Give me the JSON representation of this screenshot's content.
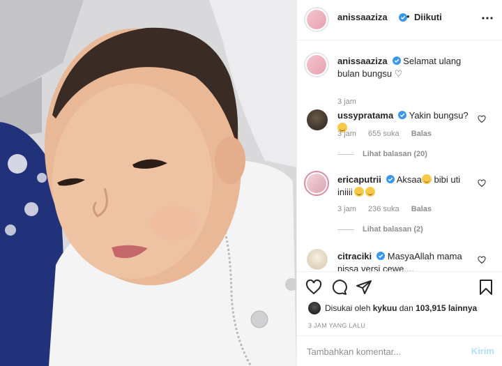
{
  "post": {
    "author": "anissaaziza",
    "follow_sep": "•",
    "follow_status": "Diikuti",
    "caption": "Selamat ulang bulan bungsu ♡",
    "caption_time": "3 jam",
    "photo_icon": "baby-photo"
  },
  "comments": [
    {
      "user": "ussypratama",
      "text": "Yakin bungsu?",
      "time": "3 jam",
      "likes": "655 suka",
      "reply": "Balas",
      "view_replies": "Lihat balasan (20)"
    },
    {
      "user": "ericaputrii",
      "text": "Aksaa",
      "text2": " bibi uti iniiii",
      "time": "3 jam",
      "likes": "236 suka",
      "reply": "Balas",
      "view_replies": "Lihat balasan (2)"
    },
    {
      "user": "citraciki",
      "text": "MasyaAllah mama nissa versi cewe...."
    }
  ],
  "likes": {
    "prefix": "Disukai oleh",
    "user": "kykuu",
    "mid": "dan",
    "count": "103,915 lainnya"
  },
  "timestamp": "3 JAM YANG LALU",
  "add_comment": {
    "placeholder": "Tambahkan komentar...",
    "send": "Kirim"
  },
  "colors": {
    "verified": "#3897f0",
    "muted": "#8e8e8e",
    "send_disabled": "#b2dffc"
  }
}
